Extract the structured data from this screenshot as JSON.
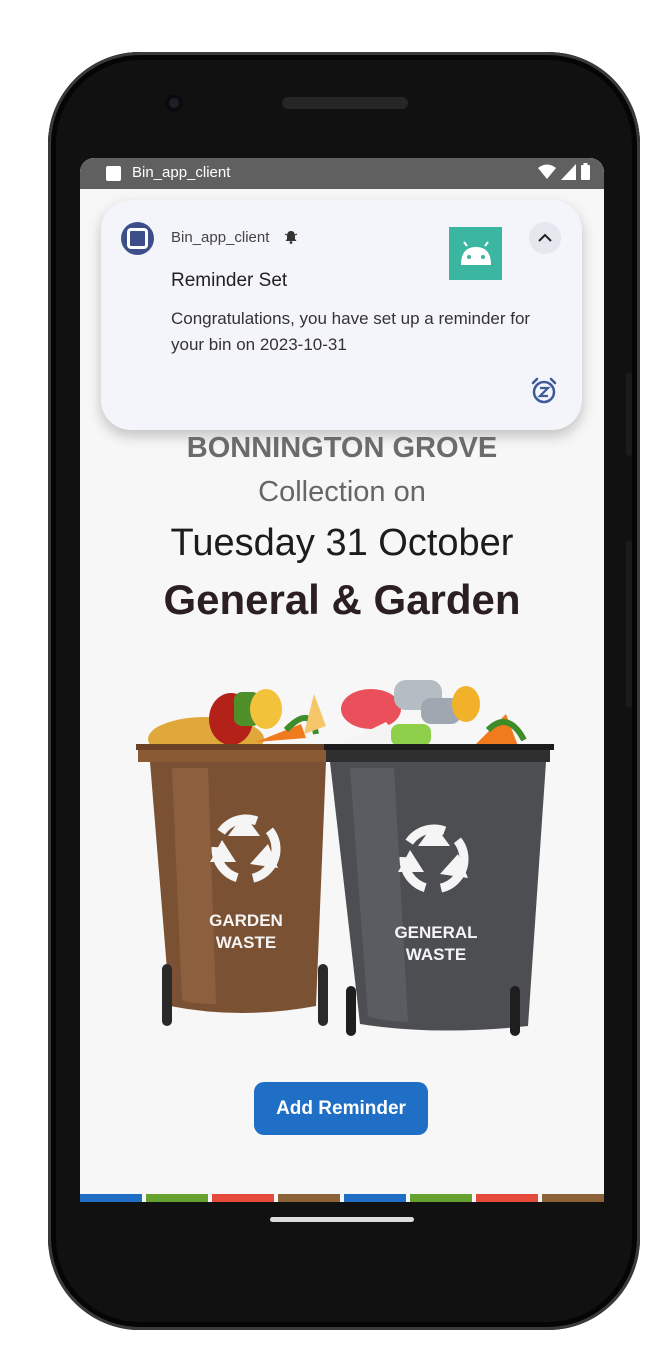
{
  "status_bar": {
    "app_title": "Bin_app_client",
    "icons": [
      "wifi-icon",
      "signal-icon",
      "battery-icon"
    ]
  },
  "notification": {
    "app_name": "Bin_app_client",
    "title": "Reminder Set",
    "body": "Congratulations, you have set up a reminder for your bin on 2023-10-31",
    "icons": [
      "app-icon",
      "alert-bell-icon",
      "android-large-icon",
      "collapse-chevron-icon",
      "snooze-icon"
    ]
  },
  "main": {
    "street": "BONNINGTON GROVE",
    "collection_label": "Collection on",
    "date": "Tuesday 31 October",
    "bin_type": "General & Garden"
  },
  "illustration": {
    "garden_bin_label_line1": "GARDEN",
    "garden_bin_label_line2": "WASTE",
    "general_bin_label_line1": "GENERAL",
    "general_bin_label_line2": "WASTE"
  },
  "actions": {
    "add_reminder_label": "Add Reminder"
  },
  "colors": {
    "accent": "#1f6fc6",
    "stripe": [
      "#1f6fc6",
      "#66a32e",
      "#e64a3c",
      "#8c6238",
      "#1f6fc6",
      "#66a32e",
      "#e64a3c",
      "#8c6238"
    ]
  }
}
